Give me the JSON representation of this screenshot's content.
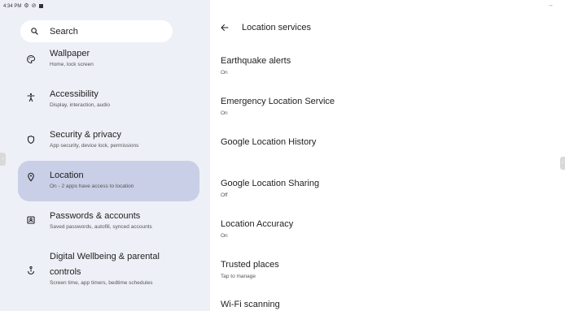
{
  "status_bar": {
    "time": "4:34 PM"
  },
  "sidebar": {
    "search_label": "Search",
    "items": [
      {
        "title": "Wallpaper",
        "subtitle": "Home, lock screen"
      },
      {
        "title": "Accessibility",
        "subtitle": "Display, interaction, audio"
      },
      {
        "title": "Security & privacy",
        "subtitle": "App security, device lock, permissions"
      },
      {
        "title": "Location",
        "subtitle": "On - 2 apps have access to location",
        "selected": true
      },
      {
        "title": "Passwords & accounts",
        "subtitle": "Saved passwords, autofill, synced accounts"
      },
      {
        "title_line1": "Digital Wellbeing & parental",
        "title_line2": "controls",
        "subtitle": "Screen time, app timers, bedtime schedules"
      }
    ]
  },
  "main": {
    "title": "Location services",
    "settings": [
      {
        "title": "Earthquake alerts",
        "subtitle": "On"
      },
      {
        "title": "Emergency Location Service",
        "subtitle": "On"
      },
      {
        "title": "Google Location History",
        "subtitle": ""
      },
      {
        "title": "Google Location Sharing",
        "subtitle": "Off"
      },
      {
        "title": "Location Accuracy",
        "subtitle": "On"
      },
      {
        "title": "Trusted places",
        "subtitle": "Tap to manage"
      },
      {
        "title": "Wi-Fi scanning",
        "subtitle": ""
      }
    ]
  },
  "colors": {
    "sidebar_bg": "#eef0f7",
    "selected_bg": "#c9cfe6",
    "text": "#1f1f1f"
  }
}
